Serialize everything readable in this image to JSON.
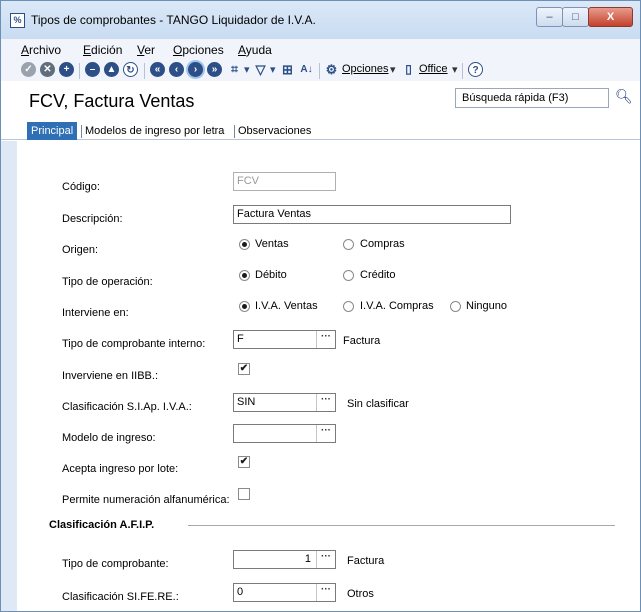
{
  "window": {
    "title": "Tipos de comprobantes - TANGO Liquidador de I.V.A.",
    "app_icon_glyph": "%",
    "controls": {
      "minimize": "–",
      "maximize": "□",
      "close": "X"
    }
  },
  "menu": {
    "items": [
      "Archivo",
      "Edición",
      "Ver",
      "Opciones",
      "Ayuda"
    ]
  },
  "toolbar": {
    "opciones_label": "Opciones",
    "office_label": "Office",
    "help_glyph": "?",
    "icons": [
      "check-circle-icon",
      "cancel-circle-icon",
      "add-circle-icon",
      "remove-circle-icon",
      "up-circle-icon",
      "refresh-icon",
      "first-record-icon",
      "prev-record-icon",
      "next-record-icon",
      "last-record-icon",
      "binoculars-icon",
      "filter-icon",
      "grid-icon",
      "sort-az-icon",
      "gear-icon",
      "office-icon",
      "help-icon"
    ]
  },
  "header": {
    "page_title": "FCV, Factura Ventas",
    "search_placeholder": "Búsqueda rápida (F3)"
  },
  "tabs": [
    "Principal",
    "Modelos de ingreso por letra",
    "Observaciones"
  ],
  "form": {
    "codigo": {
      "label": "Código:",
      "value": "FCV"
    },
    "descripcion": {
      "label": "Descripción:",
      "value": "Factura Ventas"
    },
    "origen": {
      "label": "Origen:",
      "options": [
        "Ventas",
        "Compras"
      ],
      "selected": "Ventas"
    },
    "tipo_operacion": {
      "label": "Tipo de operación:",
      "options": [
        "Débito",
        "Crédito"
      ],
      "selected": "Débito"
    },
    "interviene": {
      "label": "Interviene en:",
      "options": [
        "I.V.A. Ventas",
        "I.V.A. Compras",
        "Ninguno"
      ],
      "selected": "I.V.A. Ventas"
    },
    "tipo_interno": {
      "label": "Tipo de comprobante interno:",
      "value": "F",
      "desc": "Factura"
    },
    "iibb": {
      "label": "Inverviene en IIBB.:",
      "checked": true
    },
    "clasif_siap": {
      "label": "Clasificación S.I.Ap. I.V.A.:",
      "value": "SIN",
      "desc": "Sin clasificar"
    },
    "modelo": {
      "label": "Modelo de ingreso:",
      "value": ""
    },
    "lote": {
      "label": "Acepta ingreso por lote:",
      "checked": true
    },
    "alfanum": {
      "label": "Permite numeración alfanumérica:",
      "checked": false
    },
    "afip_section": "Clasificación A.F.I.P.",
    "tipo_comprobante": {
      "label": "Tipo de comprobante:",
      "value": "1",
      "desc": "Factura"
    },
    "clasif_sifere": {
      "label": "Clasificación SI.FE.RE.:",
      "value": "0",
      "desc": "Otros"
    }
  },
  "ellipsis": "···",
  "check_glyph": "✔",
  "colors": {
    "accent": "#2f6fb5",
    "close_red": "#c4412c",
    "toolbar_icon": "#2c4f87"
  }
}
